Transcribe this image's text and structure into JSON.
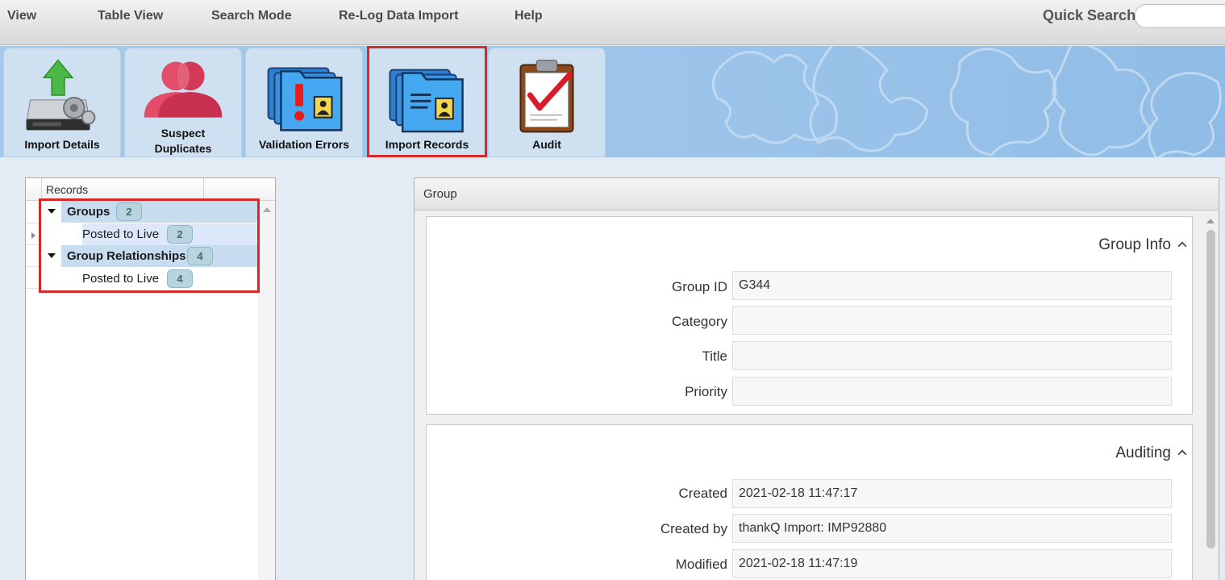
{
  "menubar": {
    "items": [
      "View",
      "Table View",
      "Search Mode",
      "Re-Log Data Import",
      "Help"
    ],
    "quick_search_label": "Quick Search",
    "quick_search_value": ""
  },
  "ribbon": {
    "tabs": [
      {
        "label": "Import Details",
        "icon": "import-details-icon"
      },
      {
        "label_line1": "Suspect",
        "label_line2": "Duplicates",
        "icon": "suspect-duplicates-icon"
      },
      {
        "label": "Validation Errors",
        "icon": "validation-errors-icon"
      },
      {
        "label": "Import Records",
        "icon": "import-records-icon",
        "selected": true
      },
      {
        "label": "Audit",
        "icon": "audit-clipboard-icon"
      }
    ],
    "highlight_color": "#d62a2a"
  },
  "tree": {
    "header": "Records",
    "nodes": [
      {
        "label": "Groups",
        "count": "2",
        "children": [
          {
            "label": "Posted to Live",
            "count": "2"
          }
        ]
      },
      {
        "label": "Group Relationships",
        "count": "4",
        "children": [
          {
            "label": "Posted to Live",
            "count": "4"
          }
        ]
      }
    ]
  },
  "detail": {
    "header": "Group",
    "group_info": {
      "title": "Group Info",
      "fields": [
        {
          "label": "Group ID",
          "value": "G344"
        },
        {
          "label": "Category",
          "value": ""
        },
        {
          "label": "Title",
          "value": ""
        },
        {
          "label": "Priority",
          "value": ""
        }
      ]
    },
    "auditing": {
      "title": "Auditing",
      "fields": [
        {
          "label": "Created",
          "value": "2021-02-18 11:47:17"
        },
        {
          "label": "Created by",
          "value": "thankQ Import: IMP92880"
        },
        {
          "label": "Modified",
          "value": "2021-02-18 11:47:19"
        }
      ]
    }
  }
}
